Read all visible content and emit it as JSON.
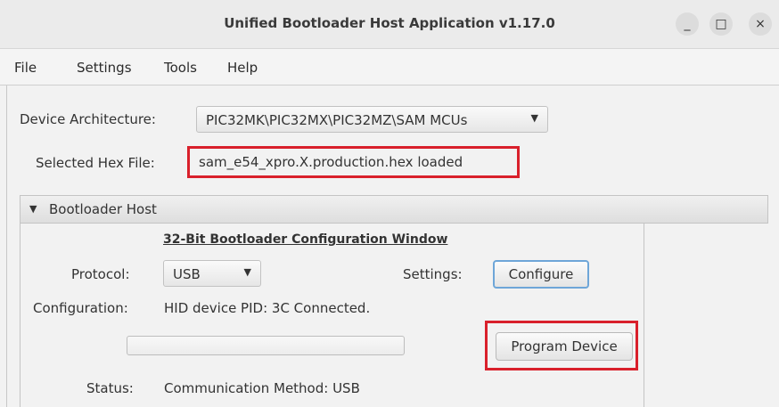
{
  "window": {
    "title": "Unified Bootloader Host Application v1.17.0",
    "controls": {
      "minimize": "_",
      "maximize": "□",
      "close": "×"
    }
  },
  "menu": [
    "File",
    "Settings",
    "Tools",
    "Help"
  ],
  "device": {
    "architecture_label": "Device Architecture:",
    "architecture_value": "PIC32MK\\PIC32MX\\PIC32MZ\\SAM MCUs",
    "hex_label": "Selected Hex File:",
    "hex_value": "sam_e54_xpro.X.production.hex loaded"
  },
  "bootloader": {
    "group_title": "Bootloader Host",
    "config_window_title": "32-Bit Bootloader Configuration Window",
    "protocol_label": "Protocol:",
    "protocol_value": "USB",
    "settings_label": "Settings:",
    "configure_label": "Configure",
    "configuration_label": "Configuration:",
    "configuration_value": "HID device PID: 3C Connected.",
    "progress": 0,
    "program_label": "Program Device",
    "status_label": "Status:",
    "status_value": "Communication Method: USB"
  },
  "colors": {
    "highlight": "#d9202b",
    "focus": "#6ea6d8"
  }
}
